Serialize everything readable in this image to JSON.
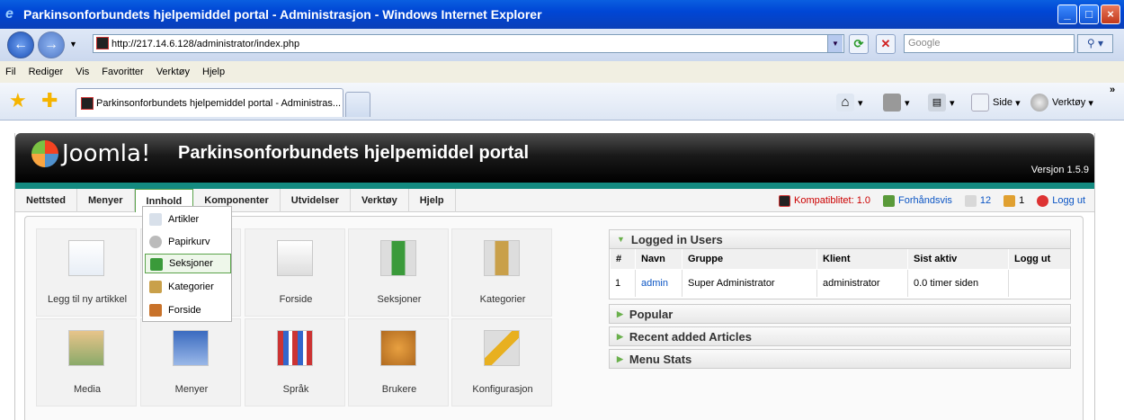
{
  "browser": {
    "title": "Parkinsonforbundets hjelpemiddel portal - Administrasjon - Windows Internet Explorer",
    "url": "http://217.14.6.128/administrator/index.php",
    "search_placeholder": "Google",
    "menu": [
      "Fil",
      "Rediger",
      "Vis",
      "Favoritter",
      "Verktøy",
      "Hjelp"
    ],
    "tab_title": "Parkinsonforbundets hjelpemiddel portal - Administras...",
    "tools": {
      "side": "Side",
      "verktoy": "Verktøy"
    }
  },
  "joomla": {
    "logo_text": "Joomla!",
    "site_name": "Parkinsonforbundets hjelpemiddel portal",
    "version": "Versjon 1.5.9",
    "menu": [
      "Nettsted",
      "Menyer",
      "Innhold",
      "Komponenter",
      "Utvidelser",
      "Verktøy",
      "Hjelp"
    ],
    "active_menu": "Innhold",
    "status": {
      "compat": "Kompatiblitet: 1.0",
      "preview": "Forhåndsvis",
      "messages": "12",
      "users": "1",
      "logout": "Logg ut"
    }
  },
  "dropdown": {
    "items": [
      "Artikler",
      "Papirkurv",
      "Seksjoner",
      "Kategorier",
      "Forside"
    ],
    "highlighted": "Seksjoner"
  },
  "icons": {
    "row1": [
      "Legg til ny artikkel",
      "",
      "Forside",
      "Seksjoner",
      "Kategorier"
    ],
    "row2": [
      "Media",
      "Menyer",
      "Språk",
      "Brukere",
      "Konfigurasjon"
    ]
  },
  "panels": {
    "logged_in": "Logged in Users",
    "popular": "Popular",
    "recent": "Recent added Articles",
    "menu_stats": "Menu Stats"
  },
  "users_table": {
    "headers": [
      "#",
      "Navn",
      "Gruppe",
      "Klient",
      "Sist aktiv",
      "Logg ut"
    ],
    "rows": [
      [
        "1",
        "admin",
        "Super Administrator",
        "administrator",
        "0.0 timer siden",
        ""
      ]
    ]
  },
  "colors": {
    "accent": "#138a80",
    "link": "#0b55c4",
    "active_border": "#5aa34a"
  }
}
